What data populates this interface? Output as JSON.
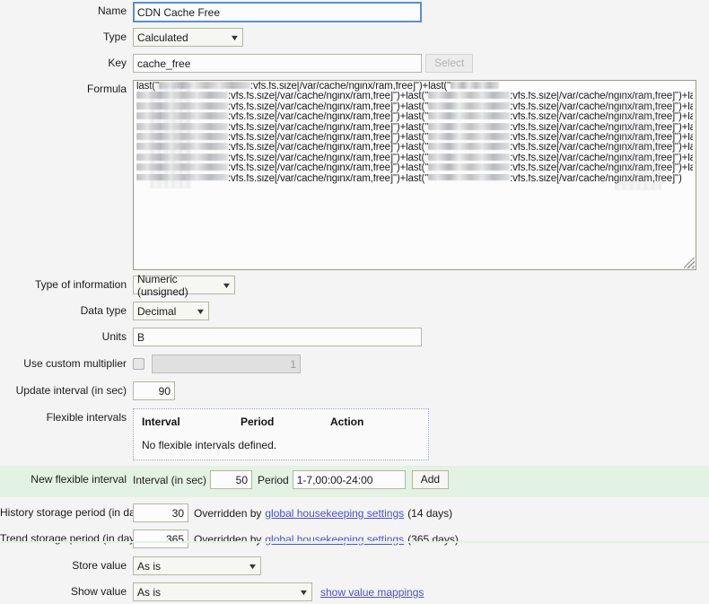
{
  "form": {
    "name": {
      "label": "Name",
      "value": "CDN Cache Free"
    },
    "type": {
      "label": "Type",
      "value": "Calculated",
      "caret": "▼"
    },
    "key": {
      "label": "Key",
      "value": "cache_free",
      "select_button": "Select"
    },
    "formula": {
      "label": "Formula",
      "lines": [
        "last(\"§§§§§§§§§§§§§§§§§§§:vfs.fs.size[/var/cache/nginx/ram,free]\")+last(\"§§§§§§§§§§",
        "§§§§§§§§§§§§§§§§§§§:vfs.fs.size[/var/cache/nginx/ram,free]\")+last(\"§§§§§§§§§§§§§§§§§:vfs.fs.size[/var/cache/nginx/ram,free]\")+last(\"",
        "§§§§§§§§§§§§§§§§§§§:vfs.fs.size[/var/cache/nginx/ram,free]\")+last(\"§§§§§§§§§§§§§§§§§:vfs.fs.size[/var/cache/nginx/ram,free]\")+last(",
        "§§§§§§§§§§§§§§§§§§§:vfs.fs.size[/var/cache/nginx/ram,free]\")+last(\"§§§§§§§§§§§§§§§§§:vfs.fs.size[/var/cache/nginx/ram,free]\")+last(",
        "§§§§§§§§§§§§§§§§§§§:vfs.fs.size[/var/cache/nginx/ram,free]\")+last(\"§§§§§§§§§§§§§§§§§:vfs.fs.size[/var/cache/nginx/ram,free]\")+last(",
        "§§§§§§§§§§§§§§§§§§§:vfs.fs.size[/var/cache/nginx/ram,free]\")+last(\"§§§§§§§§§§§§§§§§§:vfs.fs.size[/var/cache/nginx/ram,free]\")+last",
        "§§§§§§§§§§§§§§§§§§§:vfs.fs.size[/var/cache/nginx/ram,free]\")+last(\"§§§§§§§§§§§§§§§§§:vfs.fs.size[/var/cache/nginx/ram,free]\")+last(",
        "§§§§§§§§§§§§§§§§§§§:vfs.fs.size[/var/cache/nginx/ram,free]\")+last(\"§§§§§§§§§§§§§§§§§:vfs.fs.size[/var/cache/nginx/ram,free]\")+last(",
        "§§§§§§§§§§§§§§§§§§§:vfs.fs.size[/var/cache/nginx/ram,free]\")+last(\"§§§§§§§§§§§§§§§§§:vfs.fs.size[/var/cache/nginx/ram,free]\")+last(",
        "§§§§§§§§§§§§§§§§§§§:vfs.fs.size[/var/cache/nginx/ram,free]\")+last(\"§§§§§§§§§§§§§§§§§:vfs.fs.size[/var/cache/nginx/ram,free]\")"
      ],
      "redaction_note": "hostnames pixelated"
    },
    "type_of_information": {
      "label": "Type of information",
      "value": "Numeric (unsigned)",
      "caret": "▼"
    },
    "data_type": {
      "label": "Data type",
      "value": "Decimal",
      "caret": "▼"
    },
    "units": {
      "label": "Units",
      "value": "B"
    },
    "custom_multiplier": {
      "label": "Use custom multiplier",
      "checked": false,
      "value": "1"
    },
    "update_interval": {
      "label": "Update interval (in sec)",
      "value": "90"
    },
    "flexible_intervals": {
      "label": "Flexible intervals",
      "columns": [
        "Interval",
        "Period",
        "Action"
      ],
      "empty_text": "No flexible intervals defined."
    },
    "new_flexible_interval": {
      "label": "New flexible interval",
      "interval_label": "Interval (in sec)",
      "interval_value": "50",
      "period_label": "Period",
      "period_value": "1-7,00:00-24:00",
      "add_button": "Add"
    },
    "history_storage": {
      "label": "History storage period (in days)",
      "value": "30",
      "override_prefix": "Overridden by",
      "override_link": "global housekeeping settings",
      "override_suffix": "(14 days)"
    },
    "trend_storage": {
      "label": "Trend storage period (in days)",
      "value": "365",
      "override_prefix": "Overridden by",
      "override_link": "global housekeeping settings",
      "override_suffix": "(365 days)"
    },
    "store_value": {
      "label": "Store value",
      "value": "As is",
      "caret": "▼"
    },
    "show_value": {
      "label": "Show value",
      "value": "As is",
      "caret": "▼",
      "mappings_link": "show value mappings"
    }
  },
  "colors": {
    "page_background": "#f4f4f4",
    "highlight_row": "#e3f3e3",
    "focus_border": "#5b8fd0",
    "link": "#4a52c4",
    "input_border": "#b5b5a5"
  }
}
